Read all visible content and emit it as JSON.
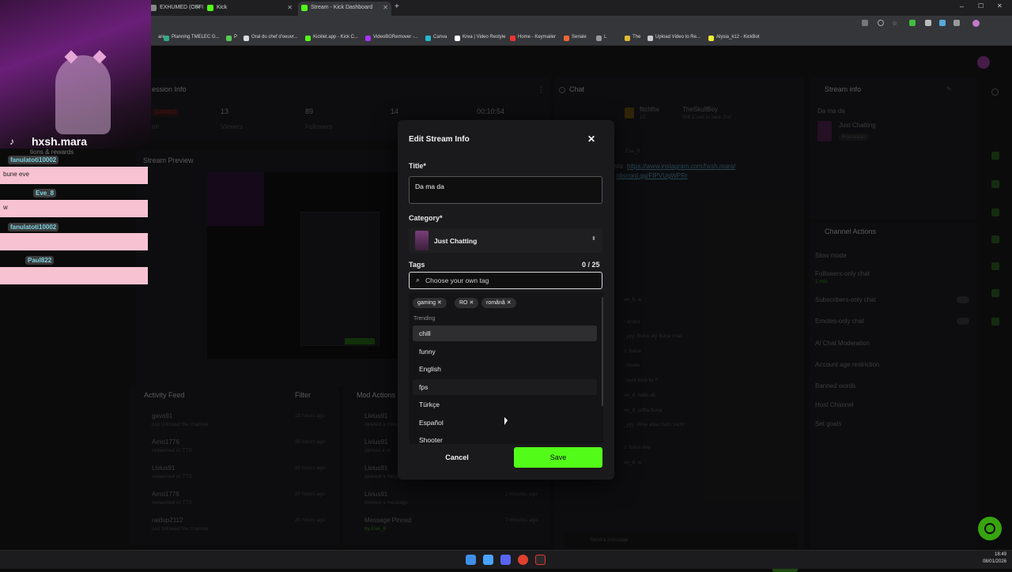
{
  "browser": {
    "tabs": [
      {
        "label": "EXHUMED (OFFI",
        "active": false
      },
      {
        "label": "Kick",
        "active": false
      },
      {
        "label": "Stream - Kick Dashboard",
        "active": true
      }
    ],
    "bookmarks": [
      "are",
      "Planning TMELEC G...",
      "P",
      "Oral du chef d'oeuvr...",
      "Kicklet.app - Kick C...",
      "VideoBGRemover -...",
      "Canva",
      "Krea | Video Restyle",
      "Home - Keymailer",
      "Seriale",
      "L",
      "The",
      "Upload Video to Re...",
      "Alysia_k12 - KickBot"
    ]
  },
  "dashboard": {
    "session_info": {
      "title": "ession Info",
      "badge": "GAMING",
      "stats": [
        {
          "value": "13",
          "label": "Viewers"
        },
        {
          "value": "89",
          "label": "Followers"
        },
        {
          "value": "14",
          "label": ""
        },
        {
          "value": "00:10:54",
          "label": ""
        }
      ],
      "stream_label": "on"
    },
    "stream_preview": {
      "title": "Stream Preview"
    },
    "chat": {
      "title": "Chat",
      "users": [
        "fitchftw",
        "TheSkullBoy",
        "10"
      ],
      "sub_text": "Gift 1 sub to take 2nd",
      "pinned_user": "Eve_8",
      "link_prefix": "sta:",
      "link1": "https://www.instagram.com/hxsh.mara/",
      "link2": "/discord.gg/FfPVUgWPRr",
      "messages": [
        "ve_8: w",
        ": w laur",
        "_yyy: Buna aly Buna chat",
        "s: buna",
        ": neata",
        ": sunt bine tu ?",
        "ve_8: hello all",
        "ve_8: pofta buna",
        "_yyy: Bine abia mam trezit",
        "s: buna eve",
        "ve_8: w"
      ],
      "placeholder": "Send a message",
      "bottom_count": "0",
      "send_label": "Chat"
    },
    "stream_info": {
      "title": "Stream info",
      "stream_title": "Da ma da",
      "category": "Just Chatting",
      "language": "Romanian"
    },
    "channel_actions": {
      "title": "Channel Actions",
      "items": [
        {
          "label": "Slow mode",
          "sub": ""
        },
        {
          "label": "Followers-only chat",
          "sub": "1 min"
        },
        {
          "label": "Subscribers-only chat",
          "sub": ""
        },
        {
          "label": "Emotes-only chat",
          "sub": ""
        },
        {
          "label": "AI Chat Moderation",
          "sub": ""
        },
        {
          "label": "Account age restriction",
          "sub": ""
        },
        {
          "label": "Banned words",
          "sub": ""
        },
        {
          "label": "Host Channel",
          "sub": ""
        },
        {
          "label": "Set goals",
          "sub": ""
        }
      ]
    },
    "activity_feed": {
      "title": "Activity Feed",
      "filter": "Filter",
      "items": [
        {
          "user": "gava91",
          "action": "just followed the channel",
          "time": "18 hours ago"
        },
        {
          "user": "Arno1776",
          "action": "redeemed AI TTS",
          "time": "20 hours ago"
        },
        {
          "user": "Livius91",
          "action": "redeemed AI TTS",
          "time": "20 hours ago"
        },
        {
          "user": "Arno1776",
          "action": "redeemed AI TTS",
          "time": "20 hours ago"
        },
        {
          "user": "raidup2112",
          "action": "just followed the channel",
          "time": "20 hours ago"
        }
      ]
    },
    "mod_actions": {
      "title": "Mod Actions",
      "items": [
        {
          "user": "Livius91",
          "action": "deleted a message",
          "time": ""
        },
        {
          "user": "Livius91",
          "action": "dimisio a m",
          "time": ""
        },
        {
          "user": "Livius91",
          "action": "deleted a message",
          "time": ""
        },
        {
          "user": "Livius91",
          "action": "deleted a message",
          "time": "2 minutes ago"
        },
        {
          "user": "Message Pinned",
          "action": "by Eve_8",
          "time": "7 minutes ago"
        }
      ]
    }
  },
  "modal": {
    "title": "Edit Stream Info",
    "title_label": "Title*",
    "title_value": "Da ma da",
    "category_label": "Category*",
    "category_value": "Just Chatting",
    "tags_label": "Tags",
    "tags_count": "0 / 25",
    "tags_placeholder": "Choose your own tag",
    "selected_tags": [
      "gaming",
      "RO",
      "română"
    ],
    "trending_label": "Trending",
    "options": [
      "chill",
      "funny",
      "English",
      "fps",
      "Türkçe",
      "Español",
      "Shooter"
    ],
    "cancel_label": "Cancel",
    "save_label": "Save"
  },
  "tiktok": {
    "username": "hxsh.mara",
    "sub_text": "tions & rewards",
    "chats": [
      {
        "name": "fanulatoti10002",
        "msg": "bune eve"
      },
      {
        "name": "Eve_8",
        "msg": "w"
      },
      {
        "name": "fanulatoti10002",
        "msg": ""
      },
      {
        "name": "Paul822",
        "msg": ""
      }
    ]
  },
  "taskbar": {
    "time": "18:49",
    "date": "08/01/2026"
  },
  "colors": {
    "accent": "#53fc18",
    "modal_bg": "#1a1a1c",
    "pink": "#f7c2d2"
  }
}
